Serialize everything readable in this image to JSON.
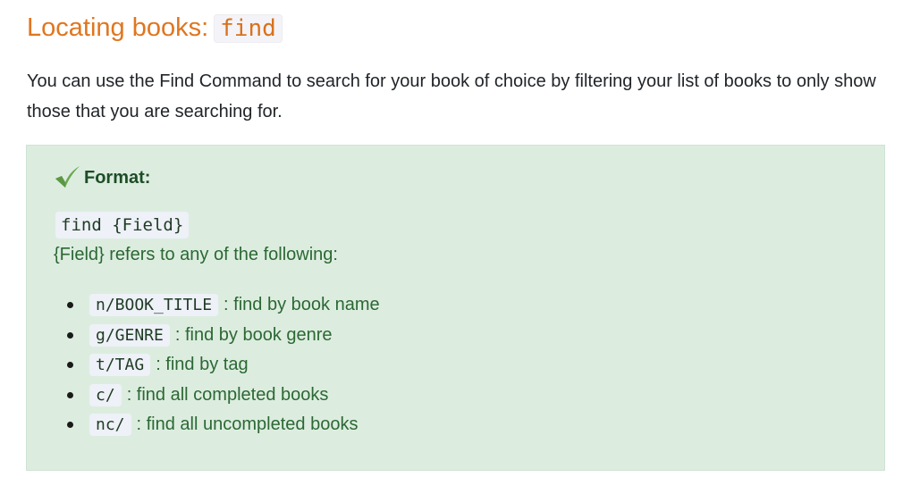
{
  "heading": {
    "text": "Locating books:",
    "command": "find"
  },
  "intro": "You can use the Find Command to search for your book of choice by filtering your list of books to only show those that you are searching for.",
  "format_box": {
    "icon": "check-icon",
    "title": "Format:",
    "syntax": "find {Field}",
    "field_description": "{Field} refers to any of the following:",
    "options": [
      {
        "code": "n/BOOK_TITLE",
        "desc": ": find by book name"
      },
      {
        "code": "g/GENRE",
        "desc": ": find by book genre"
      },
      {
        "code": "t/TAG",
        "desc": ": find by tag"
      },
      {
        "code": "c/",
        "desc": ": find all completed books"
      },
      {
        "code": "nc/",
        "desc": ": find all uncompleted books"
      }
    ]
  },
  "colors": {
    "heading": "#e0761f",
    "box_background": "#dcede0",
    "box_text": "#2c6833"
  }
}
